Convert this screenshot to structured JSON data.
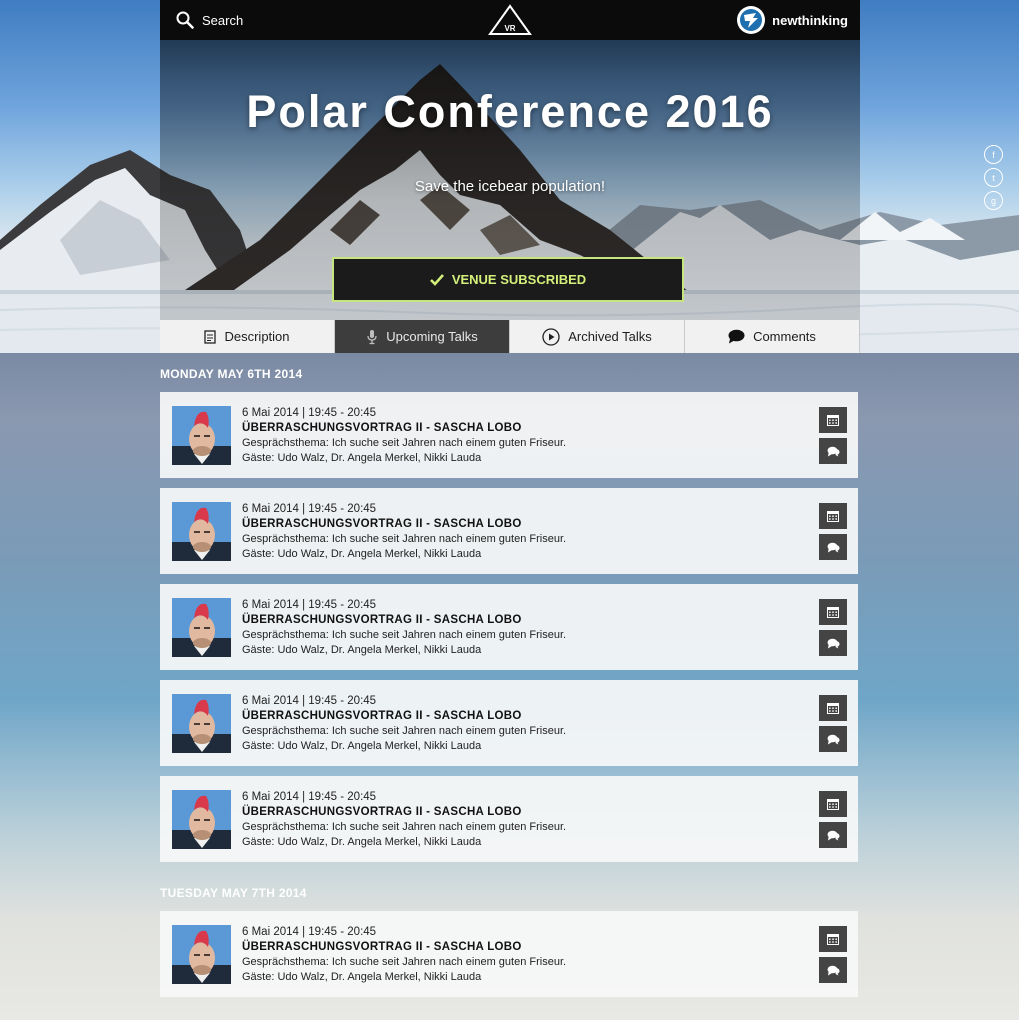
{
  "header": {
    "search_label": "Search",
    "logo_text": "VR",
    "brand_name": "newthinking"
  },
  "hero": {
    "title": "Polar Conference 2016",
    "subtitle": "Save the icebear population!",
    "subscribe_label": "VENUE SUBSCRIBED"
  },
  "social": [
    "facebook-icon",
    "twitter-icon",
    "google-plus-icon"
  ],
  "tabs": [
    {
      "label": "Description",
      "icon": "document-icon",
      "active": false
    },
    {
      "label": "Upcoming Talks",
      "icon": "microphone-icon",
      "active": true
    },
    {
      "label": "Archived Talks",
      "icon": "play-icon",
      "active": false
    },
    {
      "label": "Comments",
      "icon": "comment-icon",
      "active": false
    }
  ],
  "days": [
    {
      "label": "MONDAY MAY 6TH 2014",
      "talks": [
        {
          "time": "6 Mai 2014 | 19:45 - 20:45",
          "title": "ÜBERRASCHUNGSVORTRAG II - SASCHA LOBO",
          "topic": "Gesprächsthema: Ich suche seit Jahren nach einem guten Friseur.",
          "guests": "Gäste: Udo Walz, Dr. Angela Merkel, Nikki Lauda"
        },
        {
          "time": "6 Mai 2014 | 19:45 - 20:45",
          "title": "ÜBERRASCHUNGSVORTRAG II - SASCHA LOBO",
          "topic": "Gesprächsthema: Ich suche seit Jahren nach einem guten Friseur.",
          "guests": "Gäste: Udo Walz, Dr. Angela Merkel, Nikki Lauda"
        },
        {
          "time": "6 Mai 2014 | 19:45 - 20:45",
          "title": "ÜBERRASCHUNGSVORTRAG II - SASCHA LOBO",
          "topic": "Gesprächsthema: Ich suche seit Jahren nach einem guten Friseur.",
          "guests": "Gäste: Udo Walz, Dr. Angela Merkel, Nikki Lauda"
        },
        {
          "time": "6 Mai 2014 | 19:45 - 20:45",
          "title": "ÜBERRASCHUNGSVORTRAG II - SASCHA LOBO",
          "topic": "Gesprächsthema: Ich suche seit Jahren nach einem guten Friseur.",
          "guests": "Gäste: Udo Walz, Dr. Angela Merkel, Nikki Lauda"
        },
        {
          "time": "6 Mai 2014 | 19:45 - 20:45",
          "title": "ÜBERRASCHUNGSVORTRAG II - SASCHA LOBO",
          "topic": "Gesprächsthema: Ich suche seit Jahren nach einem guten Friseur.",
          "guests": "Gäste: Udo Walz, Dr. Angela Merkel, Nikki Lauda"
        }
      ]
    },
    {
      "label": "TUESDAY MAY 7TH 2014",
      "talks": [
        {
          "time": "6 Mai 2014 | 19:45 - 20:45",
          "title": "ÜBERRASCHUNGSVORTRAG II - SASCHA LOBO",
          "topic": "Gesprächsthema: Ich suche seit Jahren nach einem guten Friseur.",
          "guests": "Gäste: Udo Walz, Dr. Angela Merkel, Nikki Lauda"
        }
      ]
    }
  ],
  "colors": {
    "accent": "#c7e57f",
    "topbar": "#0b0b0b",
    "tab_active": "#3d3d3d",
    "action_button": "#444444"
  }
}
